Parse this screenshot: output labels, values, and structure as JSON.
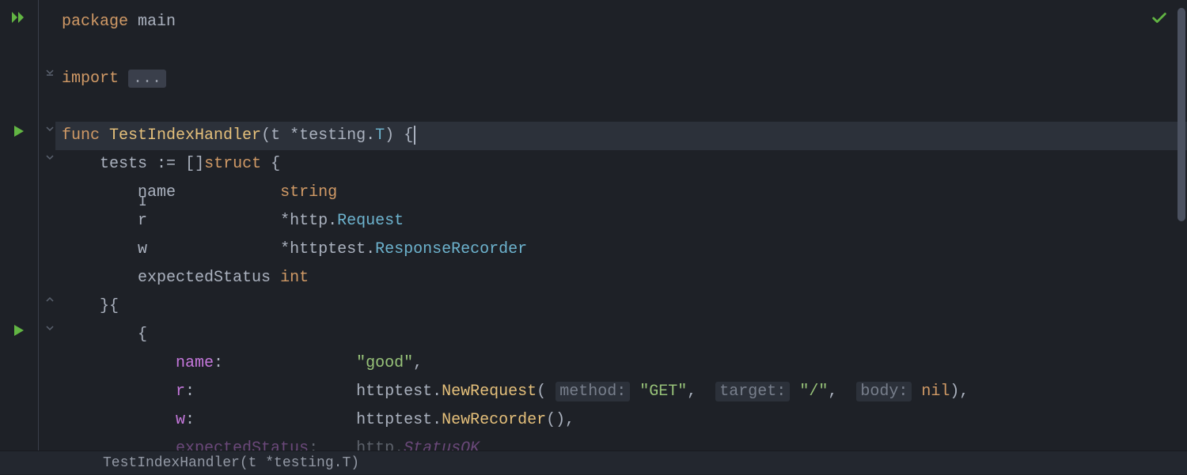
{
  "breadcrumb": "TestIndexHandler(t *testing.T)",
  "code": {
    "line1": {
      "kw": "package",
      "ident": "main"
    },
    "line3": {
      "kw": "import",
      "fold": "..."
    },
    "line5": {
      "kw": "func",
      "fname": "TestIndexHandler",
      "paren_open": "(",
      "param": "t",
      "star": "*",
      "pkg": "testing",
      "dot": ".",
      "type": "T",
      "paren_close": ")",
      "brace": "{"
    },
    "line6": {
      "ident": "tests",
      "op": ":=",
      "bracket": "[]",
      "kw": "struct",
      "brace": "{"
    },
    "line7": {
      "field": "name",
      "type": "string"
    },
    "line8": {
      "field": "r",
      "star": "*",
      "pkg": "http",
      "dot": ".",
      "type": "Request"
    },
    "line9": {
      "field": "w",
      "star": "*",
      "pkg": "httptest",
      "dot": ".",
      "type": "ResponseRecorder"
    },
    "line10": {
      "field": "expectedStatus",
      "type": "int"
    },
    "line11": {
      "close": "}{"
    },
    "line12": {
      "brace": "{"
    },
    "line13": {
      "field": "name",
      "colon": ":",
      "val": "\"good\"",
      "comma": ","
    },
    "line14": {
      "field": "r",
      "colon": ":",
      "pkg": "httptest",
      "dot": ".",
      "method": "NewRequest",
      "p_open": "(",
      "hint1": "method:",
      "arg1": "\"GET\"",
      "c1": ",",
      "hint2": "target:",
      "arg2": "\"/\"",
      "c2": ",",
      "hint3": "body:",
      "arg3": "nil",
      "p_close": "),",
      "end": ""
    },
    "line15": {
      "field": "w",
      "colon": ":",
      "pkg": "httptest",
      "dot": ".",
      "method": "NewRecorder",
      "parens": "(),"
    },
    "line16": {
      "field": "expectedStatus",
      "colon": ":",
      "pkg": "http",
      "dot": ".",
      "const": "StatusOK"
    }
  }
}
